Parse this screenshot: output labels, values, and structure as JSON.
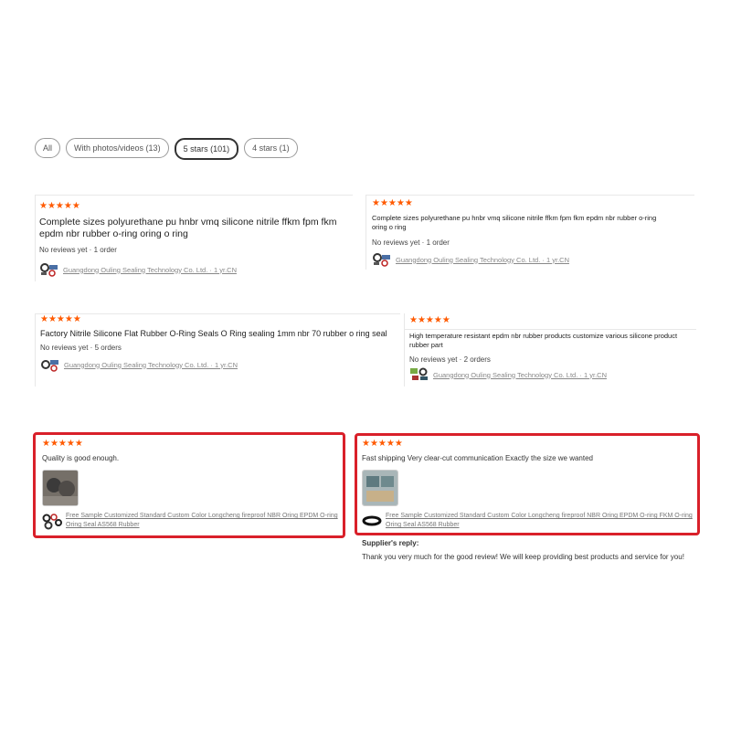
{
  "filters": [
    {
      "label": "All",
      "active": false
    },
    {
      "label": "With photos/videos (13)",
      "active": false
    },
    {
      "label": "5 stars (101)",
      "active": true
    },
    {
      "label": "4 stars (1)",
      "active": false
    }
  ],
  "stars": "★★★★★",
  "products": [
    {
      "title": "Complete sizes polyurethane pu hnbr vmq silicone nitrile ffkm fpm fkm epdm nbr rubber o-ring oring o ring",
      "meta": "No reviews yet · 1 order",
      "supplier": "Guangdong Ouling Sealing Technology Co. Ltd. · 1 yr.CN"
    },
    {
      "title": "Complete sizes polyurethane pu hnbr vmq silicone nitrile ffkm fpm fkm epdm nbr rubber o-ring oring o ring",
      "meta": "No reviews yet · 1 order",
      "supplier": "Guangdong Ouling Sealing Technology Co. Ltd. · 1 yr.CN"
    },
    {
      "title": "Factory Nitrile Silicone Flat Rubber O-Ring Seals O Ring sealing 1mm nbr 70 rubber o ring seal",
      "meta": "No reviews yet · 5 orders",
      "supplier": "Guangdong Ouling Sealing Technology Co. Ltd. · 1 yr.CN"
    },
    {
      "title": "High temperature resistant epdm nbr rubber products customize various silicone product rubber part",
      "meta": "No reviews yet · 2 orders",
      "supplier": "Guangdong Ouling Sealing Technology Co. Ltd. · 1 yr.CN"
    }
  ],
  "reviews": [
    {
      "comment": "Quality is good enough.",
      "product_link": "Free Sample Customized Standard Custom Color Longcheng fireproof NBR Oring EPDM O-ring Oring Seal AS568 Rubber"
    },
    {
      "comment": "Fast shipping Very clear-cut communication Exactly the size we wanted",
      "product_link": "Free Sample Customized Standard Custom Color Longcheng fireproof NBR Oring EPDM O-ring FKM O-ring Oring Seal AS568 Rubber",
      "reply_heading": "Supplier's reply:",
      "reply_text": "Thank you very much for the good review! We will keep providing best products and service for you!"
    }
  ],
  "colors": {
    "star": "#ff5a00",
    "highlight_border": "#d9202a"
  },
  "icons": {
    "supplier_logo": "seal-logo-icon",
    "ring_logo": "o-ring-icon"
  }
}
